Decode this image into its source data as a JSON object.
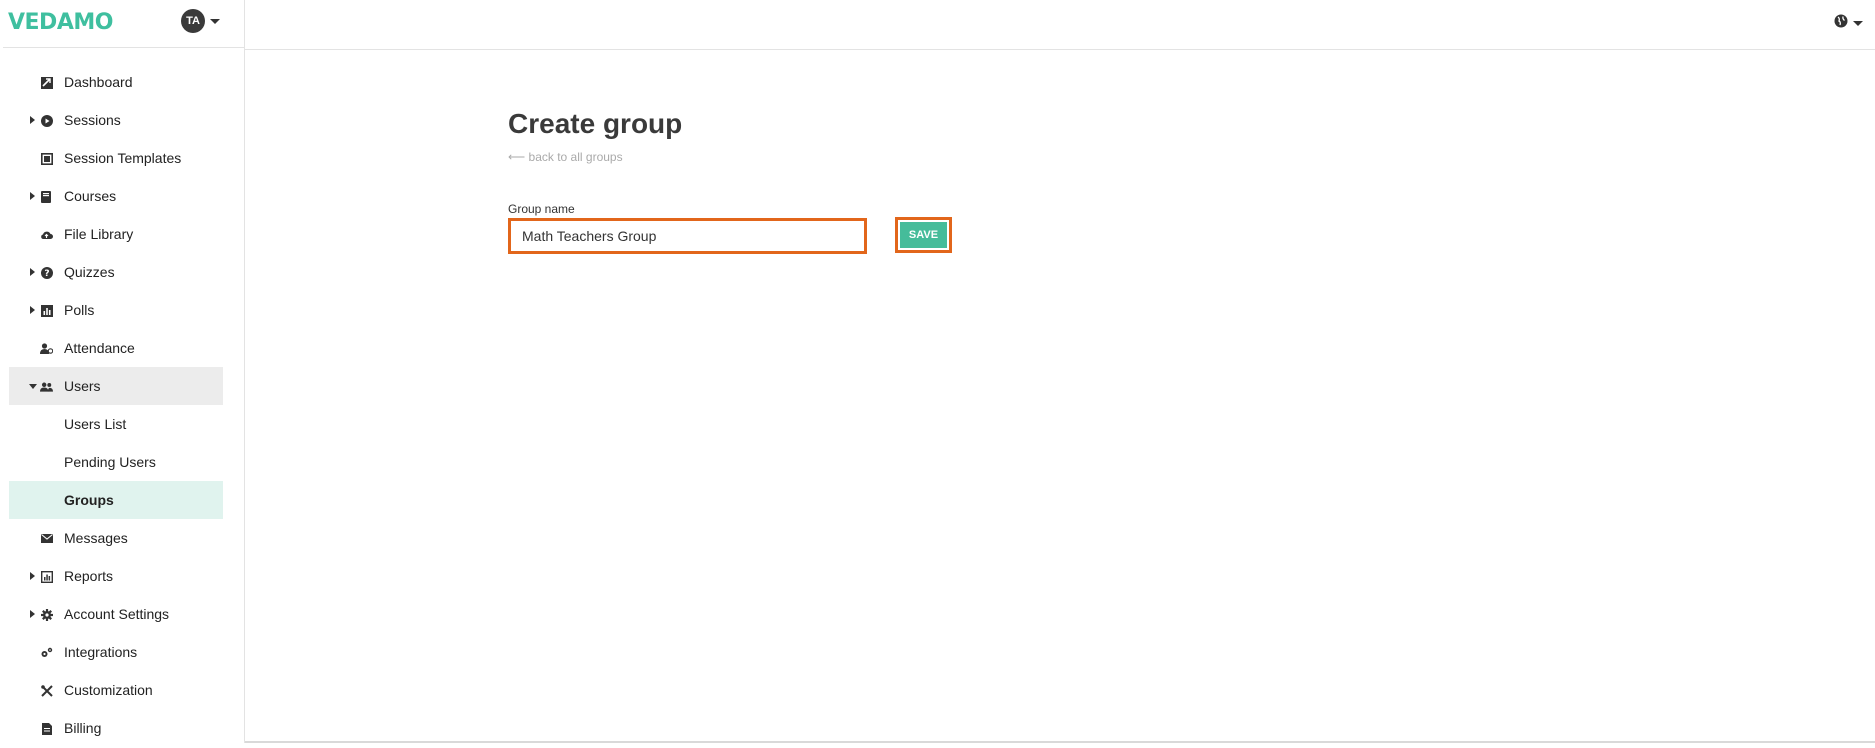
{
  "brand": {
    "name": "VEDAMO"
  },
  "user": {
    "initials": "TA"
  },
  "sidebar": {
    "items": [
      {
        "label": "Dashboard",
        "icon": "dashboard-icon",
        "expandable": false
      },
      {
        "label": "Sessions",
        "icon": "play-circle-icon",
        "expandable": true
      },
      {
        "label": "Session Templates",
        "icon": "template-icon",
        "expandable": false
      },
      {
        "label": "Courses",
        "icon": "book-icon",
        "expandable": true
      },
      {
        "label": "File Library",
        "icon": "cloud-upload-icon",
        "expandable": false
      },
      {
        "label": "Quizzes",
        "icon": "question-circle-icon",
        "expandable": true
      },
      {
        "label": "Polls",
        "icon": "poll-chart-icon",
        "expandable": true
      },
      {
        "label": "Attendance",
        "icon": "user-check-icon",
        "expandable": false
      },
      {
        "label": "Users",
        "icon": "users-icon",
        "expandable": true,
        "open": true
      },
      {
        "label": "Users List",
        "sub": true
      },
      {
        "label": "Pending Users",
        "sub": true
      },
      {
        "label": "Groups",
        "sub": true,
        "active": true
      },
      {
        "label": "Messages",
        "icon": "envelope-icon",
        "expandable": false
      },
      {
        "label": "Reports",
        "icon": "report-chart-icon",
        "expandable": true
      },
      {
        "label": "Account Settings",
        "icon": "gear-icon",
        "expandable": true
      },
      {
        "label": "Integrations",
        "icon": "cogs-icon",
        "expandable": false
      },
      {
        "label": "Customization",
        "icon": "tools-icon",
        "expandable": false
      },
      {
        "label": "Billing",
        "icon": "invoice-icon",
        "expandable": false
      }
    ]
  },
  "page": {
    "title": "Create group",
    "back_link": "⟵ back to all groups",
    "field_label": "Group name",
    "group_name_value": "Math Teachers Group",
    "save_label": "SAVE"
  },
  "colors": {
    "brand": "#3fbf9f",
    "save_button": "#45bc9a",
    "highlight_border": "#e2661b",
    "active_item_bg": "#e0f3ee",
    "open_section_bg": "#ececec"
  }
}
